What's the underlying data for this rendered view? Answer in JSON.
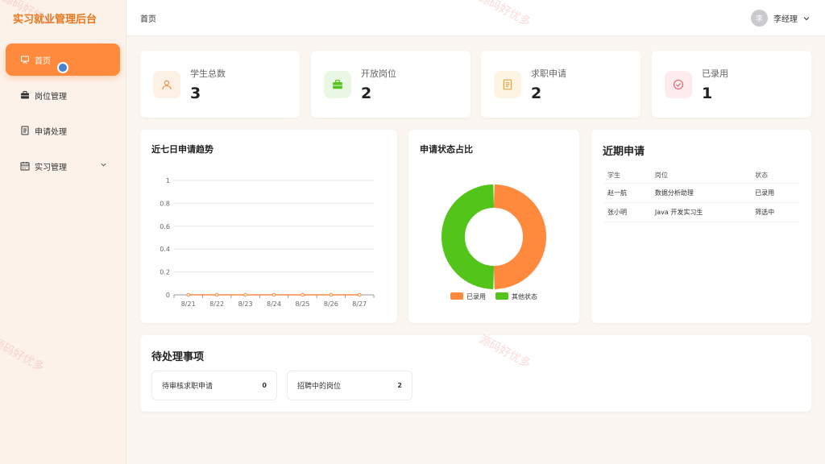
{
  "brand": "实习就业管理后台",
  "sidebar": {
    "items": [
      {
        "label": "首页",
        "icon": "presentation-icon"
      },
      {
        "label": "岗位管理",
        "icon": "briefcase-icon"
      },
      {
        "label": "申请处理",
        "icon": "document-icon"
      },
      {
        "label": "实习管理",
        "icon": "calendar-icon"
      }
    ]
  },
  "header": {
    "breadcrumb": "首页",
    "user_avatar": "李",
    "user_name": "李经理"
  },
  "stats": [
    {
      "label": "学生总数",
      "value": "3",
      "icon": "user-icon",
      "color": "#f08a3c"
    },
    {
      "label": "开放岗位",
      "value": "2",
      "icon": "briefcase-icon",
      "color": "#52c41a"
    },
    {
      "label": "求职申请",
      "value": "2",
      "icon": "document-icon",
      "color": "#e6a23c"
    },
    {
      "label": "已录用",
      "value": "1",
      "icon": "check-circle-icon",
      "color": "#e35d6a"
    }
  ],
  "trend": {
    "title": "近七日申请趋势",
    "chart_data": {
      "type": "line",
      "categories": [
        "8/21",
        "8/22",
        "8/23",
        "8/24",
        "8/25",
        "8/26",
        "8/27"
      ],
      "values": [
        0,
        0,
        0,
        0,
        0,
        0,
        0
      ],
      "ylim": [
        0,
        1
      ],
      "yticks": [
        "0",
        "0.2",
        "0.4",
        "0.6",
        "0.8",
        "1"
      ],
      "color": "#ff8a3d",
      "grid": true
    }
  },
  "status": {
    "title": "申请状态占比",
    "chart_data": {
      "type": "pie",
      "labels": [
        "已录用",
        "其他状态"
      ],
      "values": [
        1,
        1
      ],
      "colors": [
        "#ff8a3d",
        "#52c41a"
      ],
      "legend": "bottom"
    }
  },
  "recent": {
    "title": "近期申请",
    "columns": [
      "学生",
      "岗位",
      "状态"
    ],
    "rows": [
      [
        "赵一航",
        "数据分析助理",
        "已录用"
      ],
      [
        "张小明",
        "Java 开发实习生",
        "筛选中"
      ]
    ]
  },
  "pending": {
    "title": "待处理事项",
    "items": [
      {
        "label": "待审核求职申请",
        "count": "0"
      },
      {
        "label": "招聘中的岗位",
        "count": "2"
      }
    ]
  },
  "watermark": "源码好优多"
}
